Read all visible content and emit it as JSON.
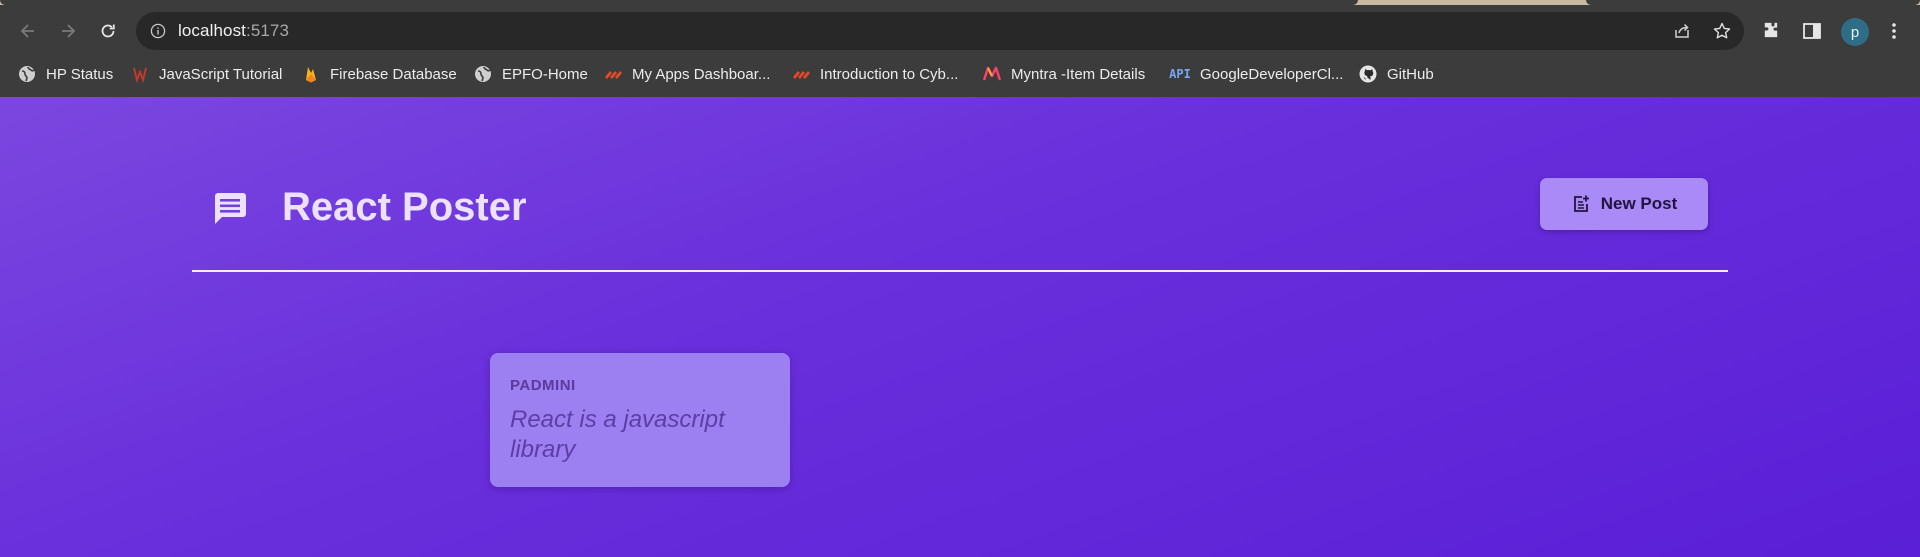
{
  "browser": {
    "url_host": "localhost",
    "url_port": ":5173",
    "profile_initial": "p",
    "bookmarks": [
      {
        "label": "HP Status",
        "icon": "globe-icon"
      },
      {
        "label": "JavaScript Tutorial",
        "icon": "w3-icon"
      },
      {
        "label": "Firebase Database",
        "icon": "firebase-icon"
      },
      {
        "label": "EPFO-Home",
        "icon": "globe-icon"
      },
      {
        "label": "My Apps Dashboar...",
        "icon": "apps-icon"
      },
      {
        "label": "Introduction to Cyb...",
        "icon": "apps-icon"
      },
      {
        "label": "Myntra -Item Details",
        "icon": "myntra-icon"
      },
      {
        "label": "GoogleDeveloperCl...",
        "icon": "api-icon"
      },
      {
        "label": "GitHub",
        "icon": "github-icon"
      }
    ],
    "api_badge": "API"
  },
  "app": {
    "title": "React Poster",
    "new_post_label": "New Post"
  },
  "posts": [
    {
      "author": "PADMINI",
      "body": "React is a javascript library"
    }
  ],
  "colors": {
    "page_gradient_start": "#7b47df",
    "page_gradient_end": "#5a1fd6",
    "card_bg": "#9c7ff0",
    "button_bg": "#a98af7"
  }
}
